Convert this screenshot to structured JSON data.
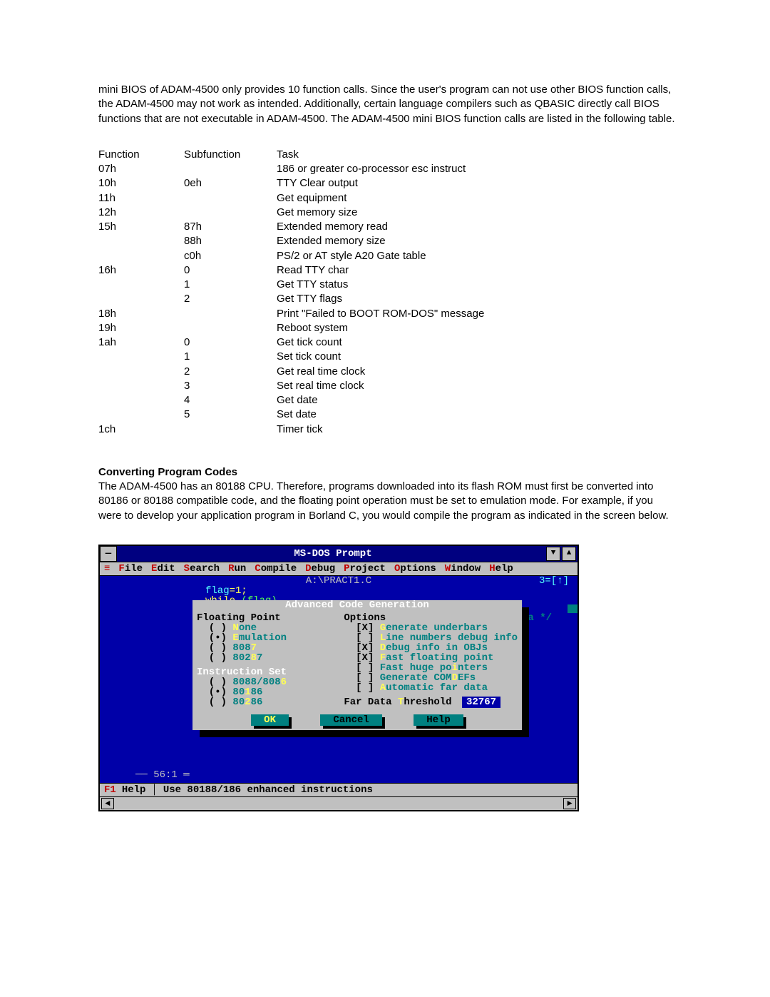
{
  "intro": "mini BIOS of ADAM-4500 only provides 10 function calls. Since the user's program can not use other BIOS function calls, the ADAM-4500 may not work as intended. Additionally, certain language compilers such as QBASIC directly call BIOS functions that are not executable in ADAM-4500. The ADAM-4500 mini BIOS function calls are listed in the following table.",
  "heading_convert": "Converting Program Codes",
  "convert_para": "The ADAM-4500 has an 80188 CPU. Therefore, programs downloaded into its flash ROM must first be converted into 80186 or 80188 compatible code, and the floating point operation must be set to emulation mode. For example, if you were to develop your application program in Borland C, you would compile the program as indicated in the screen below.",
  "table": {
    "headers": [
      "Function",
      "Subfunction",
      "Task"
    ],
    "rows": [
      [
        "07h",
        "",
        "186 or greater co-processor esc instruct"
      ],
      [
        "10h",
        "0eh",
        "TTY Clear output"
      ],
      [
        "11h",
        "",
        "Get equipment"
      ],
      [
        "12h",
        "",
        "Get memory size"
      ],
      [
        "15h",
        "87h",
        "Extended memory read"
      ],
      [
        "",
        "88h",
        "Extended memory size"
      ],
      [
        "",
        "c0h",
        "PS/2 or AT style A20 Gate table"
      ],
      [
        "16h",
        "0",
        "Read TTY char"
      ],
      [
        "",
        "1",
        "Get TTY status"
      ],
      [
        "",
        "2",
        "Get TTY flags"
      ],
      [
        "18h",
        "",
        "Print \"Failed to BOOT ROM-DOS\" message"
      ],
      [
        "19h",
        "",
        "Reboot system"
      ],
      [
        "1ah",
        "0",
        "Get tick count"
      ],
      [
        "",
        "1",
        "Set tick count"
      ],
      [
        "",
        "2",
        "Get real time clock"
      ],
      [
        "",
        "3",
        "Set real time clock"
      ],
      [
        "",
        "4",
        "Get date"
      ],
      [
        "",
        "5",
        "Set date"
      ],
      [
        "1ch",
        "",
        "Timer tick"
      ]
    ]
  },
  "dos": {
    "title": "MS-DOS Prompt",
    "menu": [
      "File",
      "Edit",
      "Search",
      "Run",
      "Compile",
      "Debug",
      "Project",
      "Options",
      "Window",
      "Help"
    ],
    "menu_hotidx": [
      0,
      0,
      0,
      0,
      0,
      0,
      0,
      0,
      0,
      0
    ],
    "filelabel": "A:\\PRACT1.C",
    "rightmark": "3=[↑]",
    "src1a": "flag",
    "src1b": "=1;",
    "src2a": "while ",
    "src2b": "(flag)",
    "trailing": "ta */",
    "pos": "── 56:1 ═",
    "dialog": {
      "title": " Advanced Code Generation ",
      "floating_hdr": "Floating Point",
      "options_hdr": "Options",
      "fp": [
        {
          "mark": "( )",
          "label": "None",
          "hot": 0
        },
        {
          "mark": "(•)",
          "label": "Emulation",
          "hot": 0
        },
        {
          "mark": "( )",
          "label": "8087",
          "hot": 3
        },
        {
          "mark": "( )",
          "label": "80287",
          "hot": 3
        }
      ],
      "instr_hdr": "Instruction Set",
      "instr": [
        {
          "mark": "( )",
          "label": "8088/8086",
          "hot": 8
        },
        {
          "mark": "(•)",
          "label": "80186",
          "hot": 2
        },
        {
          "mark": "( )",
          "label": "80286",
          "hot": 2
        }
      ],
      "opts": [
        {
          "mark": "[X]",
          "label": "Generate underbars",
          "hot": 0
        },
        {
          "mark": "[ ]",
          "label": "Line numbers debug info",
          "hot": 0
        },
        {
          "mark": "[X]",
          "label": "Debug info in OBJs",
          "hot": 0
        },
        {
          "mark": "[X]",
          "label": "Fast floating point",
          "hot": 0
        },
        {
          "mark": "[ ]",
          "label": "Fast huge pointers",
          "hot": 12
        },
        {
          "mark": "[ ]",
          "label": "Generate COMDEFs",
          "hot": 12
        },
        {
          "mark": "[ ]",
          "label": "Automatic far data",
          "hot": 0
        }
      ],
      "far_lbl": "Far Data ",
      "far_key": "T",
      "far_lbl2": "hreshold",
      "far_val": "32767",
      "btn_ok": "OK",
      "btn_cancel": "Cancel",
      "btn_help": "Help"
    },
    "status_f1": "F1",
    "status_help": "Help",
    "status_msg": "Use 80188/186 enhanced instructions"
  }
}
